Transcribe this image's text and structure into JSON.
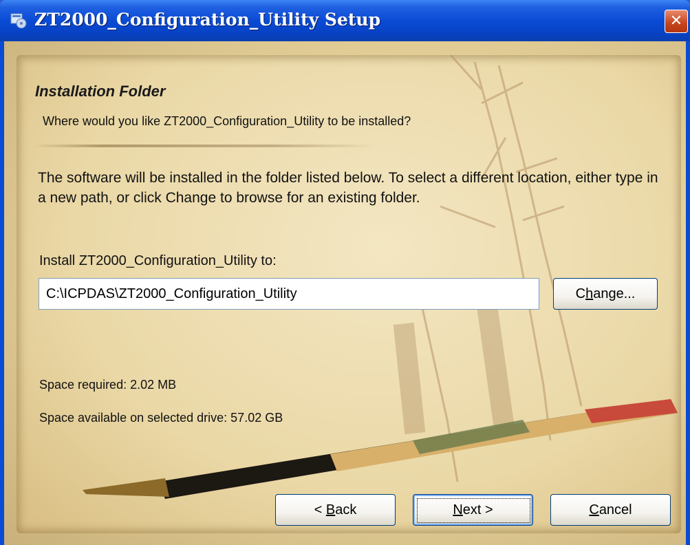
{
  "window": {
    "title": "ZT2000_Configuration_Utility Setup",
    "close_glyph": "✕"
  },
  "page": {
    "heading": "Installation Folder",
    "subheading": "Where would you like ZT2000_Configuration_Utility to be installed?",
    "description": "The software will be installed in the folder listed below. To select a different location, either type in a new path, or click Change to browse for an existing folder.",
    "install_label": "Install ZT2000_Configuration_Utility to:",
    "install_path": "C:\\ICPDAS\\ZT2000_Configuration_Utility",
    "space_required": "Space required: 2.02 MB",
    "space_available": "Space available on selected drive: 57.02 GB"
  },
  "buttons": {
    "change": {
      "pre": "C",
      "accel": "h",
      "post": "ange..."
    },
    "back": {
      "pre": "< ",
      "accel": "B",
      "post": "ack"
    },
    "next": {
      "pre": "",
      "accel": "N",
      "post": "ext >"
    },
    "cancel": {
      "pre": "",
      "accel": "C",
      "post": "ancel"
    }
  },
  "icons": {
    "app": "installer-cd-icon",
    "close": "close-icon"
  },
  "colors": {
    "titlebar": "#0a4bd6",
    "close_button": "#c5441d",
    "paper": "#ead8a6"
  }
}
